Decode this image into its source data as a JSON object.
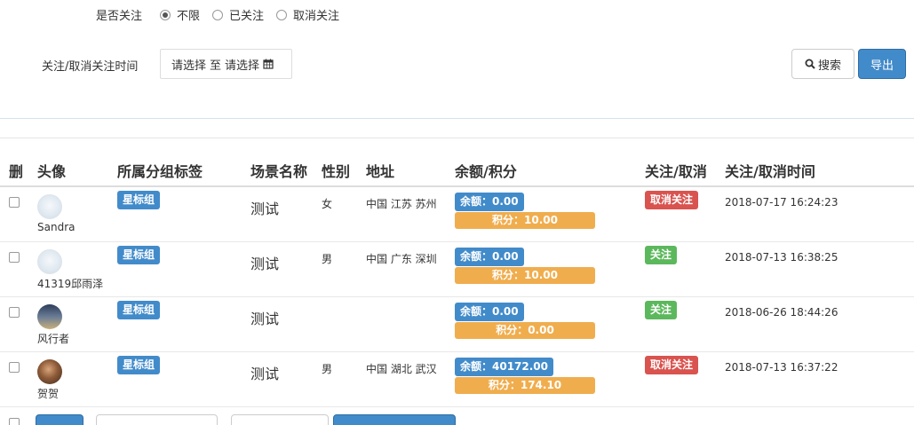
{
  "filters": {
    "follow_label": "是否关注",
    "follow_options": [
      {
        "label": "不限",
        "checked": true
      },
      {
        "label": "已关注",
        "checked": false
      },
      {
        "label": "取消关注",
        "checked": false
      }
    ],
    "time_label": "关注/取消关注时间",
    "date_start": "请选择",
    "date_sep": "至",
    "date_end": "请选择",
    "calendar_icon": "calendar-icon"
  },
  "toolbar": {
    "search_label": "搜索",
    "search_icon": "search-icon",
    "export_label": "导出"
  },
  "table": {
    "headers": {
      "del": "删",
      "avatar": "头像",
      "group": "所属分组标签",
      "scene": "场景名称",
      "gender": "性别",
      "address": "地址",
      "balance": "余额/积分",
      "follow": "关注/取消",
      "time": "关注/取消时间"
    },
    "rows": [
      {
        "nickname": "Sandra",
        "group": "星标组",
        "scene": "测试",
        "gender": "女",
        "address": "中国 江苏 苏州",
        "balance": "余额：0.00",
        "points": "积分：10.00",
        "status": "取消关注",
        "status_type": "unfollow",
        "time": "2018-07-17 16:24:23"
      },
      {
        "nickname": "41319邱雨泽",
        "group": "星标组",
        "scene": "测试",
        "gender": "男",
        "address": "中国 广东 深圳",
        "balance": "余额：0.00",
        "points": "积分：10.00",
        "status": "关注",
        "status_type": "follow",
        "time": "2018-07-13 16:38:25"
      },
      {
        "nickname": "风行者",
        "group": "星标组",
        "scene": "测试",
        "gender": "",
        "address": "",
        "balance": "余额：0.00",
        "points": "积分：0.00",
        "status": "关注",
        "status_type": "follow",
        "time": "2018-06-26 18:44:26"
      },
      {
        "nickname": "贺贺",
        "group": "星标组",
        "scene": "测试",
        "gender": "男",
        "address": "中国 湖北 武汉",
        "balance": "余额：40172.00",
        "points": "积分：174.10",
        "status": "取消关注",
        "status_type": "unfollow",
        "time": "2018-07-13 16:37:22"
      }
    ]
  },
  "colors": {
    "primary": "#428bca",
    "warning": "#f0ad4e",
    "danger": "#d9534f",
    "success": "#5cb85c"
  }
}
